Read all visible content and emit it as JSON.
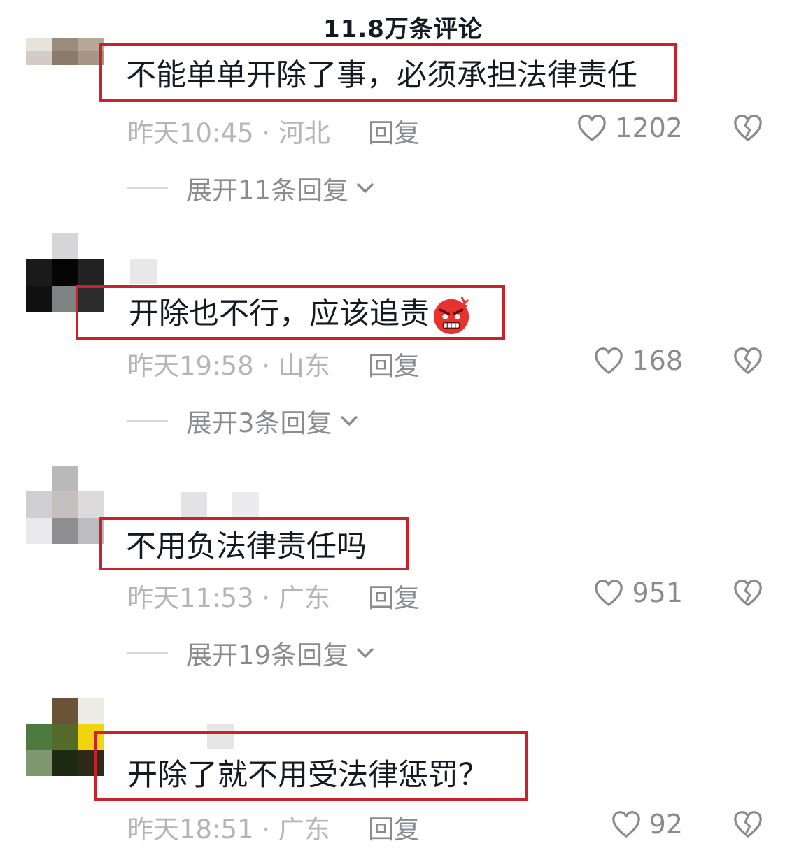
{
  "header": {
    "title": "11.8万条评论"
  },
  "comments": [
    {
      "text": "不能单单开除了事，必须承担法律责任",
      "time_location": "昨天10:45 · 河北",
      "reply_label": "回复",
      "like_count": "1202",
      "expand_label": "展开11条回复",
      "has_emoji": false
    },
    {
      "text": "开除也不行，应该追责",
      "time_location": "昨天19:58 · 山东",
      "reply_label": "回复",
      "like_count": "168",
      "expand_label": "展开3条回复",
      "has_emoji": true,
      "emoji": "angry-face"
    },
    {
      "text": "不用负法律责任吗",
      "time_location": "昨天11:53 · 广东",
      "reply_label": "回复",
      "like_count": "951",
      "expand_label": "展开19条回复",
      "has_emoji": false
    },
    {
      "text": "开除了就不用受法律惩罚？",
      "time_location": "昨天18:51 · 广东",
      "reply_label": "回复",
      "like_count": "92",
      "has_emoji": false
    }
  ],
  "icons": {
    "like": "heart-outline-icon",
    "dislike": "broken-heart-icon",
    "expand": "chevron-down-icon"
  },
  "colors": {
    "highlight_box": "#c8232c",
    "meta_text": "#b5b5b8",
    "secondary_text": "#8a8b91",
    "primary_text": "#161823"
  }
}
